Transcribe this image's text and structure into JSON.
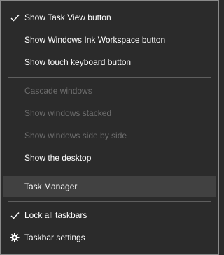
{
  "menu": {
    "items": {
      "show_task_view": {
        "label": "Show Task View button",
        "checked": true
      },
      "show_ink_workspace": {
        "label": "Show Windows Ink Workspace button"
      },
      "show_touch_keyboard": {
        "label": "Show touch keyboard button"
      },
      "cascade_windows": {
        "label": "Cascade windows",
        "disabled": true
      },
      "show_windows_stacked": {
        "label": "Show windows stacked",
        "disabled": true
      },
      "show_windows_side_by_side": {
        "label": "Show windows side by side",
        "disabled": true
      },
      "show_desktop": {
        "label": "Show the desktop"
      },
      "task_manager": {
        "label": "Task Manager",
        "highlighted": true
      },
      "lock_all_taskbars": {
        "label": "Lock all taskbars",
        "checked": true
      },
      "taskbar_settings": {
        "label": "Taskbar settings",
        "icon": "gear-icon"
      }
    }
  },
  "colors": {
    "background": "#2b2b2b",
    "text": "#ffffff",
    "disabled_text": "#6d6d6d",
    "highlight": "#414141",
    "separator": "#5e5e5e",
    "border": "#8a8a8a"
  }
}
